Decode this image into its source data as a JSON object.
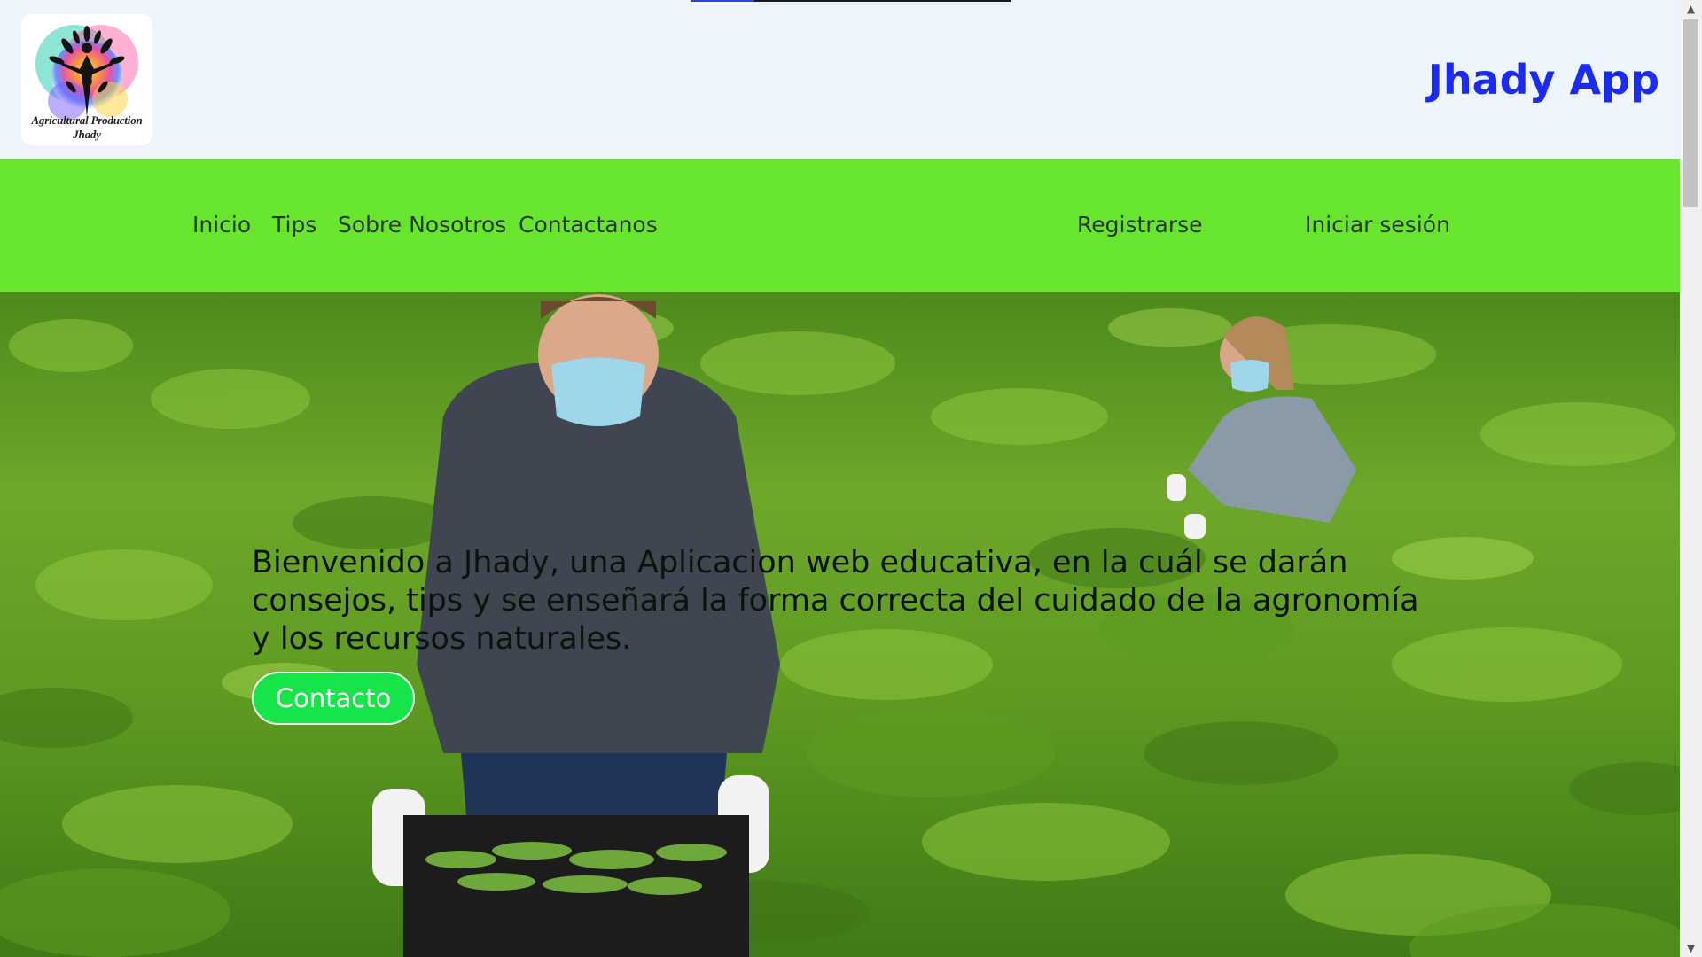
{
  "header": {
    "logo_caption": "Agricultural Production Jhady",
    "app_title": "Jhady App",
    "page_load_progress": 0.2
  },
  "nav": {
    "items": [
      {
        "label": "Inicio"
      },
      {
        "label": "Tips"
      },
      {
        "label": "Sobre Nosotros"
      },
      {
        "label": "Contactanos"
      }
    ],
    "register_label": "Registrarse",
    "login_label": "Iniciar sesión"
  },
  "hero": {
    "text": "Bienvenido a Jhady, una Aplicacion web educativa, en la cuál se darán consejos, tips y se enseñará la forma correcta del cuidado de la agronomía y los recursos naturales.",
    "button_label": "Contacto"
  },
  "colors": {
    "header_bg": "#eef4fb",
    "navbar_bg": "#68e62f",
    "title_blue": "#1b2bf0",
    "button_green": "#16e54a"
  },
  "icons": {
    "logo": "tree-of-life-figure-logo",
    "scroll_up": "triangle-up-icon",
    "scroll_down": "triangle-down-icon"
  }
}
